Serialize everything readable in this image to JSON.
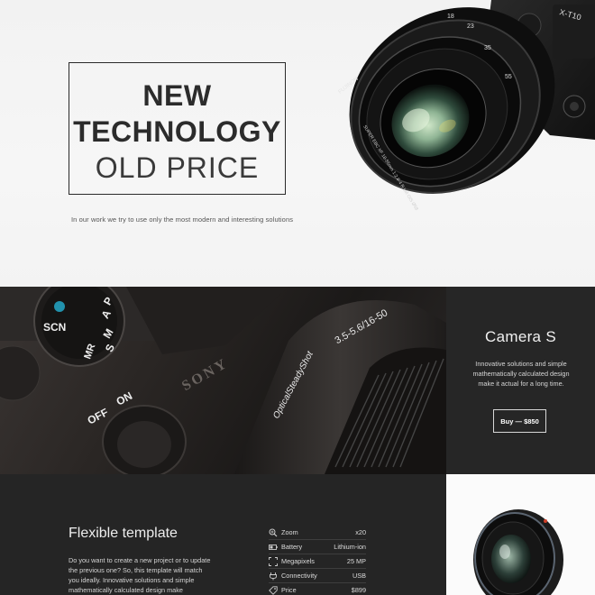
{
  "hero": {
    "title_line1": "NEW",
    "title_line2": "TECHNOLOGY",
    "title_line3": "OLD PRICE",
    "subtitle": "In our work we try to use only the most modern and interesting solutions",
    "camera_brand": "X-T10",
    "lens_text": "FUJINON",
    "lens_specs": "SUPER EBC XF 18-55mm 1:2.8-4 R LM OIS Ø58",
    "focal_marks": [
      "23",
      "18",
      "35",
      "55"
    ]
  },
  "band": {
    "brand_text": "SONY",
    "lens_text": "OpticalSteadyShot",
    "lens_range": "3.5-5.6/16-50",
    "dial_labels": [
      "SCN",
      "MR",
      "M",
      "S",
      "A",
      "P"
    ],
    "power_labels": [
      "ON",
      "OFF"
    ],
    "product_title": "Camera S",
    "product_desc": "Innovative solutions and simple mathematically calculated design make it actual for a long time.",
    "buy_label": "Buy — $850"
  },
  "bottom": {
    "title": "Flexible template",
    "desc": "Do you want to create a new project or to update the previous one? So, this template will match you ideally. Innovative solutions and simple mathematically calculated design make",
    "specs": [
      {
        "icon": "zoom-icon",
        "label": "Zoom",
        "value": "x20"
      },
      {
        "icon": "battery-icon",
        "label": "Battery",
        "value": "Lithium-ion"
      },
      {
        "icon": "megapixels-icon",
        "label": "Megapixels",
        "value": "25 MP"
      },
      {
        "icon": "connectivity-icon",
        "label": "Connectivity",
        "value": "USB"
      },
      {
        "icon": "price-tag-icon",
        "label": "Price",
        "value": "$899"
      }
    ]
  },
  "colors": {
    "hero_bg": "#f3f3f3",
    "dark_panel": "#262626",
    "text_dark": "#2b2b2b"
  }
}
